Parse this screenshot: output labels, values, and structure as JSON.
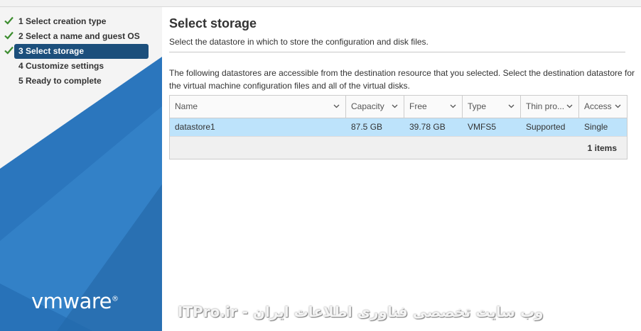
{
  "wizard": {
    "steps": [
      {
        "label": "1  Select creation type",
        "done": true
      },
      {
        "label": "2  Select a name and guest OS",
        "done": true
      },
      {
        "label": "3  Select storage",
        "done": true,
        "active": true
      },
      {
        "label": "4  Customize settings",
        "done": false
      },
      {
        "label": "5  Ready to complete",
        "done": false
      }
    ],
    "brand": "vmware"
  },
  "page": {
    "title": "Select storage",
    "description": "Select the datastore in which to store the configuration and disk files.",
    "intro": "The following datastores are accessible from the destination resource that you selected. Select the destination datastore for the virtual machine configuration files and all of the virtual disks."
  },
  "grid": {
    "columns": [
      "Name",
      "Capacity",
      "Free",
      "Type",
      "Thin pro...",
      "Access"
    ],
    "rows": [
      [
        "datastore1",
        "87.5 GB",
        "39.78 GB",
        "VMFS5",
        "Supported",
        "Single"
      ]
    ],
    "footer": "1 items"
  },
  "watermark": "ITPro.ir - وب سایت تخصصی فناوری اطلاعات ایران",
  "colors": {
    "selected_row": "#bde3fb",
    "active_step": "#1c4f7c",
    "sidebar_blue": "#2e7bc4",
    "check_green": "#3c8d2f"
  }
}
